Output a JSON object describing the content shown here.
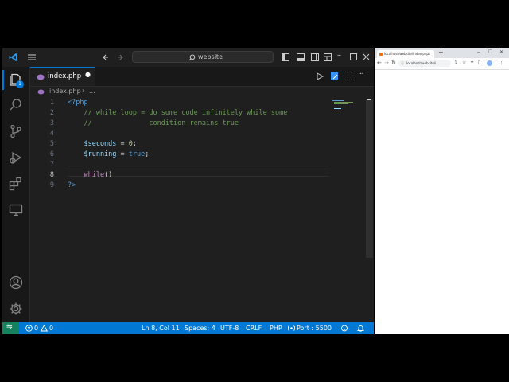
{
  "titlebar": {
    "search_placeholder": "website"
  },
  "activity_bar": {
    "items": [
      "explorer-icon",
      "search-icon",
      "source-control-icon",
      "run-debug-icon",
      "extensions-icon",
      "remote-explorer-icon"
    ],
    "explorer_badge": "1",
    "bottom": [
      "account-icon",
      "settings-gear-icon"
    ]
  },
  "tab": {
    "filename": "index.php",
    "dirty": "●"
  },
  "breadcrumb": {
    "file": "index.php",
    "separator": "›",
    "more": "..."
  },
  "editor": {
    "line_numbers": [
      "1",
      "2",
      "3",
      "4",
      "5",
      "6",
      "7",
      "8",
      "9"
    ],
    "active_line": "8",
    "lines": [
      [
        {
          "t": "<?php",
          "c": "tk-pm"
        }
      ],
      [
        {
          "t": "    // while loop = do some code infinitely while some",
          "c": "tk-c"
        }
      ],
      [
        {
          "t": "    //              condition remains true",
          "c": "tk-c"
        }
      ],
      [],
      [
        {
          "t": "    $seconds",
          "c": "tk-v"
        },
        {
          "t": " = ",
          "c": "tk-w"
        },
        {
          "t": "0",
          "c": "tk-n"
        },
        {
          "t": ";",
          "c": "tk-w"
        }
      ],
      [
        {
          "t": "    $running",
          "c": "tk-v"
        },
        {
          "t": " = ",
          "c": "tk-w"
        },
        {
          "t": "true",
          "c": "tk-k"
        },
        {
          "t": ";",
          "c": "tk-w"
        }
      ],
      [],
      [
        {
          "t": "    while",
          "c": "tk-p"
        },
        {
          "t": "()",
          "c": "tk-w"
        }
      ],
      [
        {
          "t": "?>",
          "c": "tk-pm"
        }
      ]
    ]
  },
  "statusbar": {
    "remote": "⇋",
    "errors": "0",
    "warnings": "0",
    "cursor": "Ln 8, Col 11",
    "spaces": "Spaces: 4",
    "encoding": "UTF-8",
    "eol": "CRLF",
    "language": "PHP",
    "port": "Port : 5500"
  },
  "browser": {
    "tab_title": "localhost/website/index.php",
    "new_tab": "+",
    "address": "localhost/website/i..."
  },
  "colors": {
    "accent": "#0078d4",
    "statusbar": "#0078d4",
    "editor_bg": "#1f1f1f"
  }
}
